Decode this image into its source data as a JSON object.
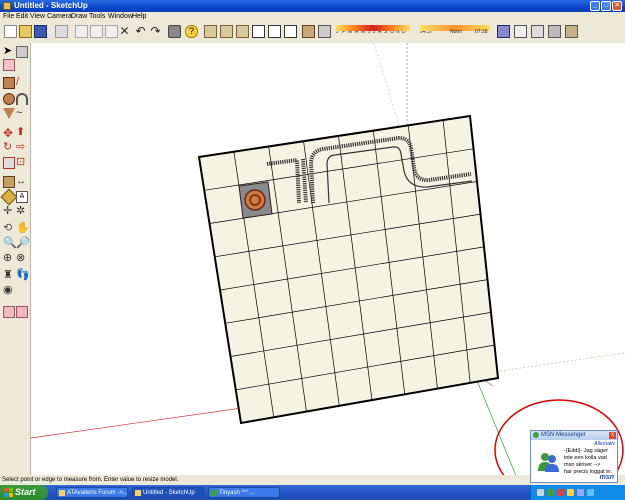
{
  "window": {
    "title": "Untitled - SketchUp"
  },
  "menu": [
    "File",
    "Edit",
    "View",
    "Camera",
    "Draw",
    "Tools",
    "Window",
    "Help"
  ],
  "shadow_settings": {
    "months": [
      "J",
      "F",
      "M",
      "A",
      "M",
      "J",
      "J",
      "A",
      "S",
      "O",
      "N",
      "D"
    ],
    "time_start": "04:37",
    "time_mid": "Noon",
    "time_end": "07:28"
  },
  "status": {
    "text": "Select point or edge to measure from.  Enter value to resize model."
  },
  "taskbar": {
    "start_label": "Start",
    "tasks": [
      "ATAvaitens Forum ->...",
      "Untitled - SketchUp",
      "Tinyash ^^' ..."
    ]
  },
  "msn": {
    "title": "MSN Messenger",
    "alternatives": "Alternativ",
    "message_lines": [
      "-{Eddi}- Jag säger",
      "inte een kolla vad",
      "msn skriver -->",
      "har precis loggat in."
    ],
    "logo": "msn"
  },
  "colors": {
    "xp_blue": "#0a46c8",
    "start_green": "#2e8a2e",
    "highlight_circle": "#e00000",
    "board_fill": "#f5f3e3"
  }
}
